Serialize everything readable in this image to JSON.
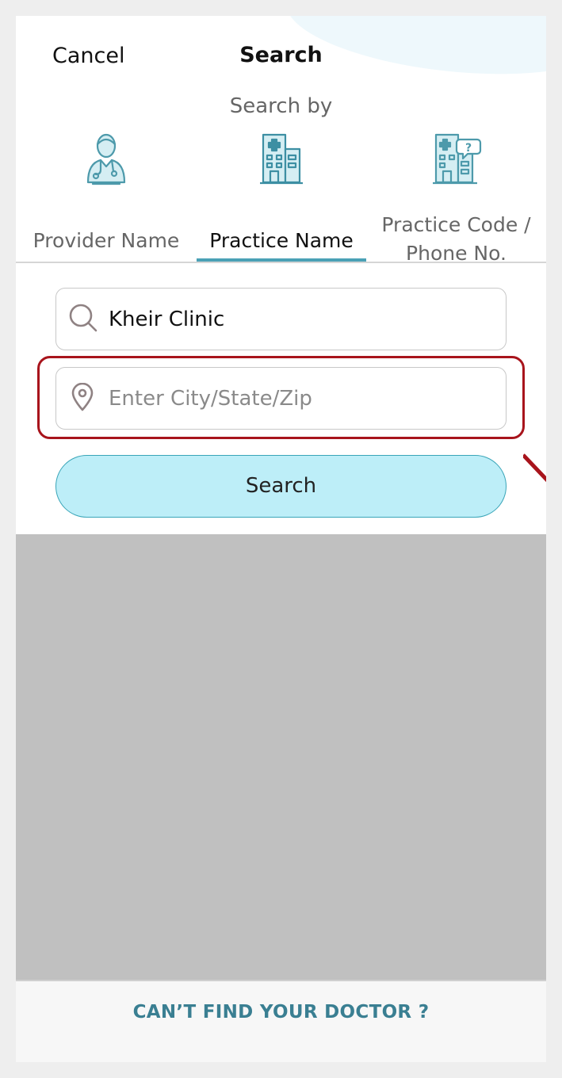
{
  "header": {
    "cancel_label": "Cancel",
    "title": "Search",
    "search_by_label": "Search by"
  },
  "tabs": [
    {
      "label": "Provider Name",
      "icon": "doctor-icon",
      "active": false
    },
    {
      "label": "Practice Name",
      "icon": "hospital-icon",
      "active": true
    },
    {
      "label_line1": "Practice Code /",
      "label_line2": "Phone No.",
      "icon": "hospital-question-icon",
      "active": false
    }
  ],
  "form": {
    "practice_value": "Kheir Clinic",
    "location_placeholder": "Enter City/State/Zip",
    "search_button_label": "Search"
  },
  "footer": {
    "link_label": "CAN’T FIND YOUR DOCTOR ?"
  },
  "colors": {
    "accent": "#4aa1b6",
    "button_fill": "#bdeef8",
    "highlight": "#a8141c",
    "footer_link": "#3a7f92"
  }
}
